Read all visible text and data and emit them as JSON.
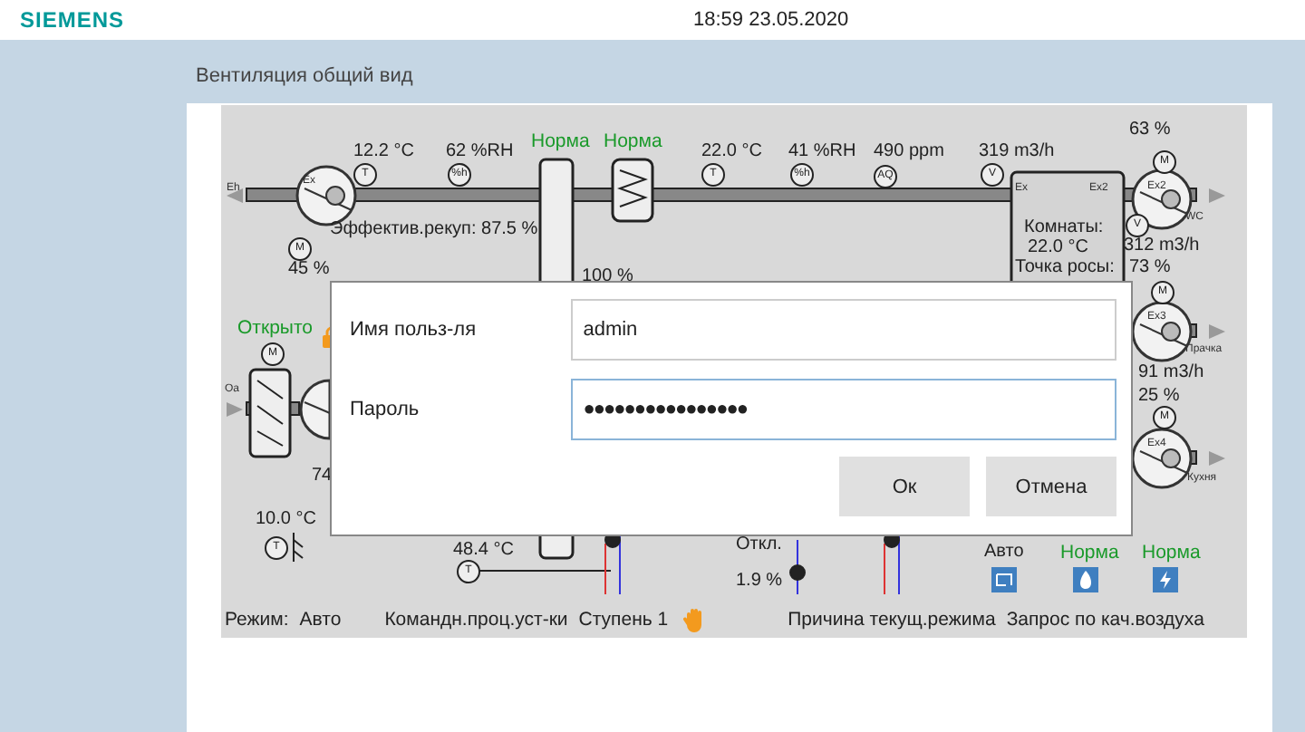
{
  "header": {
    "brand": "SIEMENS",
    "datetime": "18:59  23.05.2020"
  },
  "screen_title": "Вентиляция общий вид",
  "diagram": {
    "labels": [
      {
        "text": "12.2 °C",
        "kind": "value"
      },
      {
        "text": "62 %RH",
        "kind": "value"
      },
      {
        "text": "Норма",
        "kind": "status"
      },
      {
        "text": "Норма",
        "kind": "status"
      },
      {
        "text": "22.0 °C",
        "kind": "value"
      },
      {
        "text": "41 %RH",
        "kind": "value"
      },
      {
        "text": "490 ppm",
        "kind": "value"
      },
      {
        "text": "319 m3/h",
        "kind": "value"
      },
      {
        "text": "63 %",
        "kind": "value"
      },
      {
        "text": "Eh",
        "kind": "tag"
      },
      {
        "text": "Ex",
        "kind": "tag"
      },
      {
        "text": "Ex",
        "kind": "tag"
      },
      {
        "text": "Ex2",
        "kind": "tag"
      },
      {
        "text": "Ex2",
        "kind": "tag"
      },
      {
        "text": "WC",
        "kind": "tag"
      },
      {
        "text": "Эффектив.рекуп: 87.5 %",
        "kind": "value"
      },
      {
        "text": "45 %",
        "kind": "value"
      },
      {
        "text": "100 %",
        "kind": "value"
      },
      {
        "text": "Комнаты:",
        "kind": "value"
      },
      {
        "text": "22.0 °C",
        "kind": "value"
      },
      {
        "text": "Точка росы:",
        "kind": "value"
      },
      {
        "text": "312 m3/h",
        "kind": "value"
      },
      {
        "text": "73 %",
        "kind": "value"
      },
      {
        "text": "Открыто",
        "kind": "status"
      },
      {
        "text": "Ex3",
        "kind": "tag"
      },
      {
        "text": "Прачка",
        "kind": "tag"
      },
      {
        "text": "Oa",
        "kind": "tag"
      },
      {
        "text": "91 m3/h",
        "kind": "value"
      },
      {
        "text": "25 %",
        "kind": "value"
      },
      {
        "text": "Ex4",
        "kind": "tag"
      },
      {
        "text": "Кухня",
        "kind": "tag"
      },
      {
        "text": "74",
        "kind": "value"
      },
      {
        "text": "10.0 °C",
        "kind": "value"
      },
      {
        "text": "48.4 °C",
        "kind": "value"
      },
      {
        "text": "Откл.",
        "kind": "value"
      },
      {
        "text": "1.9 %",
        "kind": "value"
      },
      {
        "text": "Авто",
        "kind": "value"
      },
      {
        "text": "Норма",
        "kind": "status"
      },
      {
        "text": "Норма",
        "kind": "status"
      }
    ],
    "sensors": [
      {
        "symbol": "M"
      },
      {
        "symbol": "T"
      },
      {
        "symbol": "%h"
      },
      {
        "symbol": "T"
      },
      {
        "symbol": "%h"
      },
      {
        "symbol": "AQ"
      },
      {
        "symbol": "V"
      },
      {
        "symbol": "V"
      },
      {
        "symbol": "M"
      },
      {
        "symbol": "M"
      },
      {
        "symbol": "M"
      },
      {
        "symbol": "M"
      },
      {
        "symbol": "T"
      },
      {
        "symbol": "T"
      }
    ]
  },
  "status_bar": {
    "mode_label": "Режим:",
    "mode": "Авто",
    "command_label": "Командн.проц.уст-ки",
    "stage": "Ступень 1",
    "reason_label": "Причина текущ.режима",
    "reason": "Запрос по кач.воздуха"
  },
  "login_dialog": {
    "fields": [
      {
        "label": "Имя польз-ля",
        "value": "admin",
        "focused": false
      },
      {
        "label": "Пароль",
        "value": "●●●●●●●●●●●●●●●●",
        "focused": true
      }
    ],
    "buttons": [
      "Ок",
      "Отмена"
    ]
  }
}
